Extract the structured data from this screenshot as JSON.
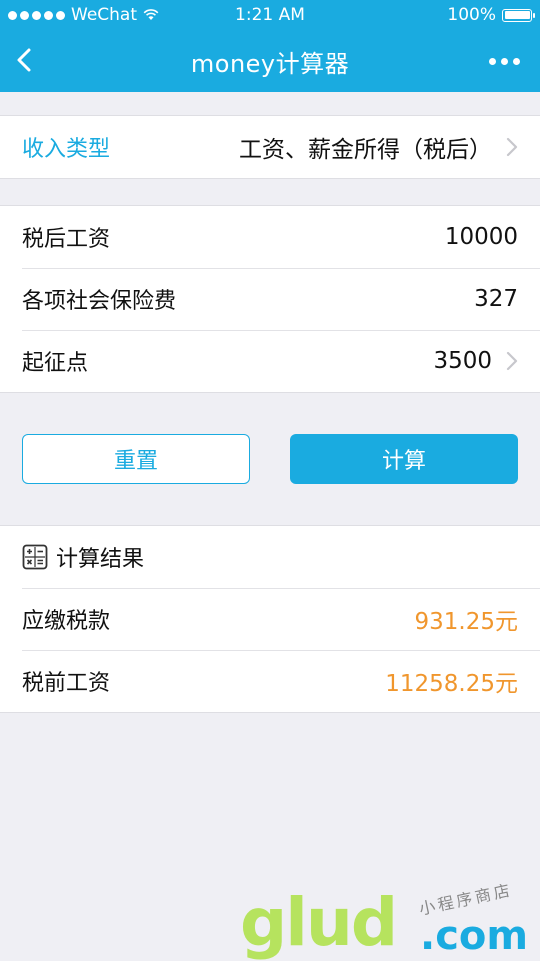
{
  "status_bar": {
    "carrier": "WeChat",
    "time": "1:21 AM",
    "battery": "100%"
  },
  "nav": {
    "title": "money计算器"
  },
  "income_type": {
    "label": "收入类型",
    "value": "工资、薪金所得（税后）"
  },
  "inputs": [
    {
      "label": "税后工资",
      "value": "10000"
    },
    {
      "label": "各项社会保险费",
      "value": "327"
    },
    {
      "label": "起征点",
      "value": "3500"
    }
  ],
  "buttons": {
    "reset": "重置",
    "calculate": "计算"
  },
  "result": {
    "title": "计算结果",
    "rows": [
      {
        "label": "应缴税款",
        "value": "931.25元"
      },
      {
        "label": "税前工资",
        "value": "11258.25元"
      }
    ]
  },
  "watermark": {
    "logo": "glud",
    "suffix": ".com",
    "tagline": "小程序商店"
  },
  "colors": {
    "accent": "#1aabe0",
    "result_value": "#f0962d",
    "background": "#efeff4"
  }
}
